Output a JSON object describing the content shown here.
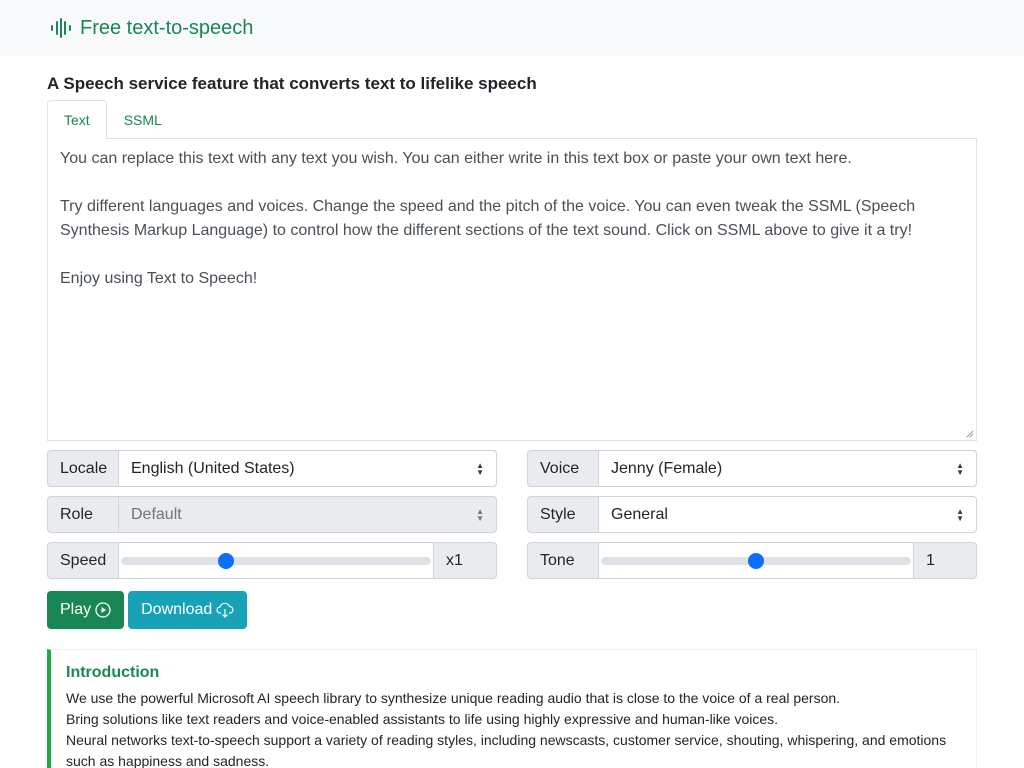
{
  "brand": {
    "name": "Free text-to-speech",
    "color": "#198754",
    "icon": "sound-wave-icon"
  },
  "page_title": "A Speech service feature that converts text to lifelike speech",
  "tabs": [
    {
      "label": "Text",
      "active": true
    },
    {
      "label": "SSML",
      "active": false
    }
  ],
  "editor": {
    "paragraphs": [
      "You can replace this text with any text you wish. You can either write in this text box or paste your own text here.",
      "Try different languages and voices. Change the speed and the pitch of the voice. You can even tweak the SSML (Speech Synthesis Markup Language) to control how the different sections of the text sound. Click on SSML above to give it a try!",
      "Enjoy using Text to Speech!"
    ]
  },
  "controls": {
    "locale": {
      "label": "Locale",
      "value": "English (United States)"
    },
    "voice": {
      "label": "Voice",
      "value": "Jenny (Female)"
    },
    "role": {
      "label": "Role",
      "value": "Default",
      "disabled": true
    },
    "style": {
      "label": "Style",
      "value": "General"
    },
    "speed": {
      "label": "Speed",
      "value": "x1",
      "level": 0.34
    },
    "tone": {
      "label": "Tone",
      "value": "1",
      "level": 0.5
    }
  },
  "buttons": {
    "play": {
      "label": "Play",
      "icon": "play-circle-icon"
    },
    "download": {
      "label": "Download",
      "icon": "cloud-download-icon"
    }
  },
  "intro": {
    "heading": "Introduction",
    "lines": [
      "We use the powerful Microsoft AI speech library to synthesize unique reading audio that is close to the voice of a real person.",
      "Bring solutions like text readers and voice-enabled assistants to life using highly expressive and human-like voices.",
      "Neural networks text-to-speech support a variety of reading styles, including newscasts, customer service, shouting, whispering, and emotions such as happiness and sadness."
    ]
  },
  "colors": {
    "accent": "#198754",
    "slider": "#0d6efd",
    "download": "#17a2b8",
    "intro_border": "#28a745"
  }
}
